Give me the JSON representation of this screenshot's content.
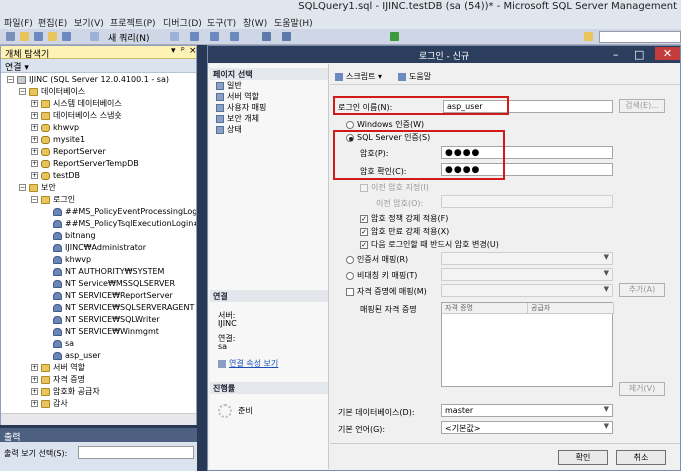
{
  "window": {
    "title": "SQLQuery1.sql - IJINC.testDB (sa (54))* - Microsoft SQL Server Management"
  },
  "menu": [
    "파일(F)",
    "편집(E)",
    "보기(V)",
    "프로젝트(P)",
    "디버그(D)",
    "도구(T)",
    "창(W)",
    "도움말(H)"
  ],
  "toolbar": {
    "new_query": "새 쿼리(N)"
  },
  "object_explorer": {
    "title": "개체 탐색기",
    "toolbar_label": "연결 ▾",
    "nodes": [
      {
        "label": "IJINC (SQL Server 12.0.4100.1 - sa)",
        "icon": "server-icon",
        "exp": "−"
      },
      {
        "label": "데이터베이스",
        "icon": "folder-icon",
        "exp": "−"
      },
      {
        "label": "시스템 데이터베이스",
        "icon": "folder-icon",
        "exp": "+"
      },
      {
        "label": "데이터베이스 스냅숏",
        "icon": "folder-icon",
        "exp": "+"
      },
      {
        "label": "khwvp",
        "icon": "database-icon",
        "exp": "+"
      },
      {
        "label": "mysite1",
        "icon": "database-icon",
        "exp": "+"
      },
      {
        "label": "ReportServer",
        "icon": "database-icon",
        "exp": "+"
      },
      {
        "label": "ReportServerTempDB",
        "icon": "database-icon",
        "exp": "+"
      },
      {
        "label": "testDB",
        "icon": "database-icon",
        "exp": "+"
      },
      {
        "label": "보안",
        "icon": "folder-icon",
        "exp": "−"
      },
      {
        "label": "로그인",
        "icon": "folder-icon",
        "exp": "−"
      },
      {
        "label": "##MS_PolicyEventProcessingLog",
        "icon": "user-icon",
        "exp": ""
      },
      {
        "label": "##MS_PolicyTsqlExecutionLogin#",
        "icon": "user-icon",
        "exp": ""
      },
      {
        "label": "bitnang",
        "icon": "user-icon",
        "exp": ""
      },
      {
        "label": "IJINC₩Administrator",
        "icon": "user-icon",
        "exp": ""
      },
      {
        "label": "khwvp",
        "icon": "user-icon",
        "exp": ""
      },
      {
        "label": "NT AUTHORITY₩SYSTEM",
        "icon": "user-icon",
        "exp": ""
      },
      {
        "label": "NT Service₩MSSQLSERVER",
        "icon": "user-icon",
        "exp": ""
      },
      {
        "label": "NT SERVICE₩ReportServer",
        "icon": "user-icon",
        "exp": ""
      },
      {
        "label": "NT SERVICE₩SQLSERVERAGENT",
        "icon": "user-icon",
        "exp": ""
      },
      {
        "label": "NT SERVICE₩SQLWriter",
        "icon": "user-icon",
        "exp": ""
      },
      {
        "label": "NT SERVICE₩Winmgmt",
        "icon": "user-icon",
        "exp": ""
      },
      {
        "label": "sa",
        "icon": "user-icon",
        "exp": ""
      },
      {
        "label": "asp_user",
        "icon": "user-icon",
        "exp": ""
      },
      {
        "label": "서버 역할",
        "icon": "folder-icon",
        "exp": "+"
      },
      {
        "label": "자격 증명",
        "icon": "folder-icon",
        "exp": "+"
      },
      {
        "label": "암호화 공급자",
        "icon": "folder-icon",
        "exp": "+"
      },
      {
        "label": "감사",
        "icon": "folder-icon",
        "exp": "+"
      }
    ]
  },
  "output": {
    "title": "출력",
    "source_label": "출력 보기 선택(S):"
  },
  "dialog": {
    "title": "로그인 - 신규",
    "left": {
      "page_select_header": "페이지 선택",
      "pages": [
        "일반",
        "서버 역할",
        "사용자 매핑",
        "보안 개체",
        "상태"
      ],
      "connection_header": "연결",
      "server_label": "서버:",
      "server_value": "IJINC",
      "conn_label": "연결:",
      "conn_value": "sa",
      "conn_link": "연결 속성 보기",
      "progress_header": "진행률",
      "progress_status": "준비"
    },
    "toolbar": {
      "script": "스크립트 ▾",
      "help": "도움말"
    },
    "form": {
      "login_name_label": "로그인 이름(N):",
      "login_name_value": "asp_user",
      "search_button": "검색(E)...",
      "windows_auth": "Windows 인증(W)",
      "sql_auth": "SQL Server 인증(S)",
      "password_label": "암호(P):",
      "password_value": "●●●●",
      "confirm_label": "암호 확인(C):",
      "confirm_value": "●●●●",
      "old_password_cb": "이전 암호 지정(I)",
      "old_password_label": "이전 암호(O):",
      "enforce_policy": "암호 정책 강제 적용(F)",
      "enforce_expiration": "암호 만료 강제 적용(X)",
      "must_change": "다음 로그인할 때 반드시 암호 변경(U)",
      "cert_mapping": "인증서 매핑(R)",
      "asym_key_mapping": "비대칭 키 매핑(T)",
      "cred_mapping": "자격 증명에 매핑(M)",
      "add_button": "추가(A)",
      "mapped_creds_label": "매핑된 자격 증명",
      "grid_col1": "자격 증명",
      "grid_col2": "공급자",
      "remove_button": "제거(V)",
      "default_db_label": "기본 데이터베이스(D):",
      "default_db_value": "master",
      "default_lang_label": "기본 언어(G):",
      "default_lang_value": "<기본값>"
    },
    "buttons": {
      "ok": "확인",
      "cancel": "취소"
    }
  }
}
